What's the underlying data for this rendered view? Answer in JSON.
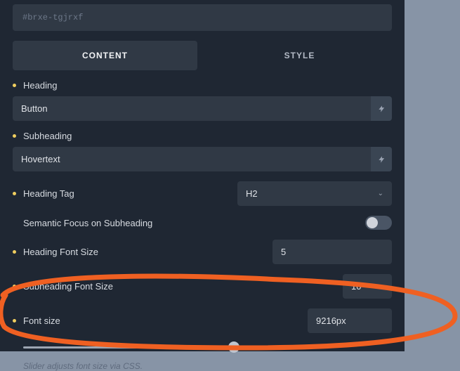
{
  "selector": "#brxe-tgjrxf",
  "tabs": {
    "content": "CONTENT",
    "style": "STYLE"
  },
  "heading": {
    "label": "Heading",
    "value": "Button"
  },
  "subheading": {
    "label": "Subheading",
    "value": "Hovertext"
  },
  "heading_tag": {
    "label": "Heading Tag",
    "value": "H2"
  },
  "semantic_focus": {
    "label": "Semantic Focus on Subheading",
    "enabled": false
  },
  "heading_font_size": {
    "label": "Heading Font Size",
    "value": "5"
  },
  "subheading_font_size": {
    "label": "Subheading Font Size",
    "value": "10"
  },
  "font_size": {
    "label": "Font size",
    "value": "9216px",
    "hint": "Slider adjusts font size via CSS."
  },
  "icons": {
    "bolt": "bolt-icon",
    "chevron": "chevron-down-icon"
  }
}
